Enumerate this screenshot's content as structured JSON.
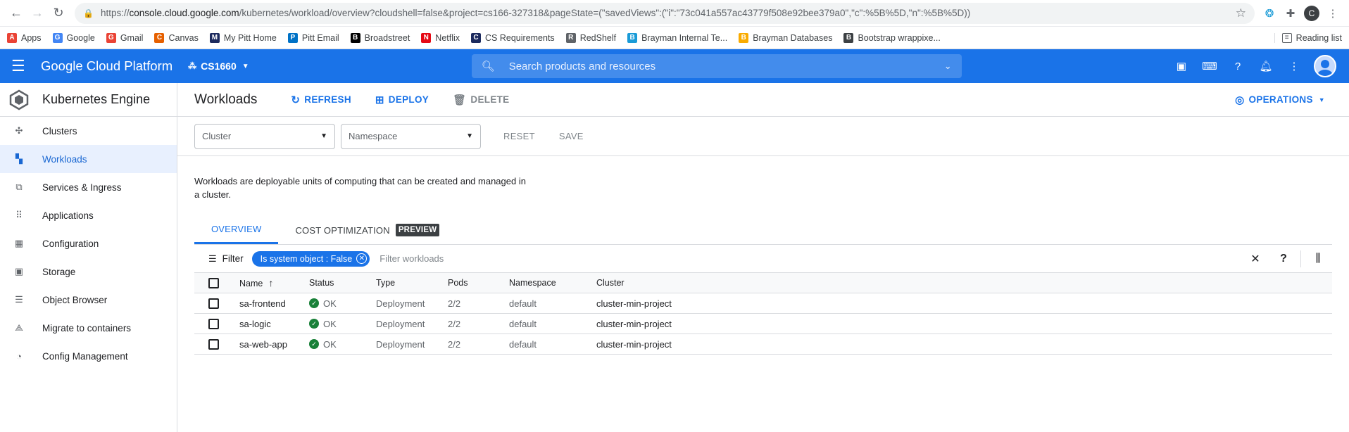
{
  "browser": {
    "url_prefix": "https://",
    "url_host": "console.cloud.google.com",
    "url_path": "/kubernetes/workload/overview?cloudshell=false&project=cs166-327318&pageState=(\"savedViews\":(\"i\":\"73c041a557ac43779f508e92bee379a0\",\"c\":%5B%5D,\"n\":%5B%5D))",
    "profile_initial": "C"
  },
  "bookmarks": [
    {
      "label": "Apps",
      "icon": "apps-grid-icon",
      "color": "#ea4335"
    },
    {
      "label": "Google",
      "icon": "google-icon",
      "color": "#4285f4"
    },
    {
      "label": "Gmail",
      "icon": "gmail-icon",
      "color": "#ea4335"
    },
    {
      "label": "Canvas",
      "icon": "canvas-icon",
      "color": "#e66000"
    },
    {
      "label": "My Pitt Home",
      "icon": "pitt-icon",
      "color": "#1c2a5e"
    },
    {
      "label": "Pitt Email",
      "icon": "outlook-icon",
      "color": "#0072c6"
    },
    {
      "label": "Broadstreet",
      "icon": "broadstreet-icon",
      "color": "#000000"
    },
    {
      "label": "Netflix",
      "icon": "netflix-icon",
      "color": "#e50914"
    },
    {
      "label": "CS Requirements",
      "icon": "cs-icon",
      "color": "#1c2a5e"
    },
    {
      "label": "RedShelf",
      "icon": "redshelf-icon",
      "color": "#5f6368"
    },
    {
      "label": "Brayman Internal Te...",
      "icon": "brayman-icon",
      "color": "#1a9bd7"
    },
    {
      "label": "Brayman Databases",
      "icon": "brayman-db-icon",
      "color": "#f9ab00"
    },
    {
      "label": "Bootstrap wrappixe...",
      "icon": "bootstrap-icon",
      "color": "#3c4043"
    }
  ],
  "reading_list": "Reading list",
  "header": {
    "title": "Google Cloud Platform",
    "project": "CS1660",
    "search_placeholder": "Search products and resources"
  },
  "sidebar": {
    "title": "Kubernetes Engine",
    "items": [
      {
        "label": "Clusters",
        "icon": "clusters-icon",
        "glyph": "✣",
        "active": false
      },
      {
        "label": "Workloads",
        "icon": "workloads-icon",
        "glyph": "▚",
        "active": true
      },
      {
        "label": "Services & Ingress",
        "icon": "services-icon",
        "glyph": "⧉",
        "active": false
      },
      {
        "label": "Applications",
        "icon": "applications-icon",
        "glyph": "⠿",
        "active": false
      },
      {
        "label": "Configuration",
        "icon": "configuration-icon",
        "glyph": "▦",
        "active": false
      },
      {
        "label": "Storage",
        "icon": "storage-icon",
        "glyph": "▣",
        "active": false
      },
      {
        "label": "Object Browser",
        "icon": "object-browser-icon",
        "glyph": "☰",
        "active": false
      },
      {
        "label": "Migrate to containers",
        "icon": "migrate-icon",
        "glyph": "⟁",
        "active": false
      },
      {
        "label": "Config Management",
        "icon": "config-management-icon",
        "glyph": "◔",
        "active": false
      }
    ]
  },
  "toolbar": {
    "title": "Workloads",
    "refresh": "REFRESH",
    "deploy": "DEPLOY",
    "delete": "DELETE",
    "operations": "OPERATIONS"
  },
  "filters": {
    "cluster": "Cluster",
    "namespace": "Namespace",
    "reset": "RESET",
    "save": "SAVE"
  },
  "description": "Workloads are deployable units of computing that can be created and managed in a cluster.",
  "tabs": {
    "overview": "OVERVIEW",
    "cost": "COST OPTIMIZATION",
    "preview": "PREVIEW"
  },
  "table_filter": {
    "label": "Filter",
    "chip": "Is system object : False",
    "placeholder": "Filter workloads"
  },
  "table": {
    "headers": {
      "name": "Name",
      "status": "Status",
      "type": "Type",
      "pods": "Pods",
      "namespace": "Namespace",
      "cluster": "Cluster"
    },
    "rows": [
      {
        "name": "sa-frontend",
        "status": "OK",
        "type": "Deployment",
        "pods": "2/2",
        "namespace": "default",
        "cluster": "cluster-min-project"
      },
      {
        "name": "sa-logic",
        "status": "OK",
        "type": "Deployment",
        "pods": "2/2",
        "namespace": "default",
        "cluster": "cluster-min-project"
      },
      {
        "name": "sa-web-app",
        "status": "OK",
        "type": "Deployment",
        "pods": "2/2",
        "namespace": "default",
        "cluster": "cluster-min-project"
      }
    ]
  }
}
